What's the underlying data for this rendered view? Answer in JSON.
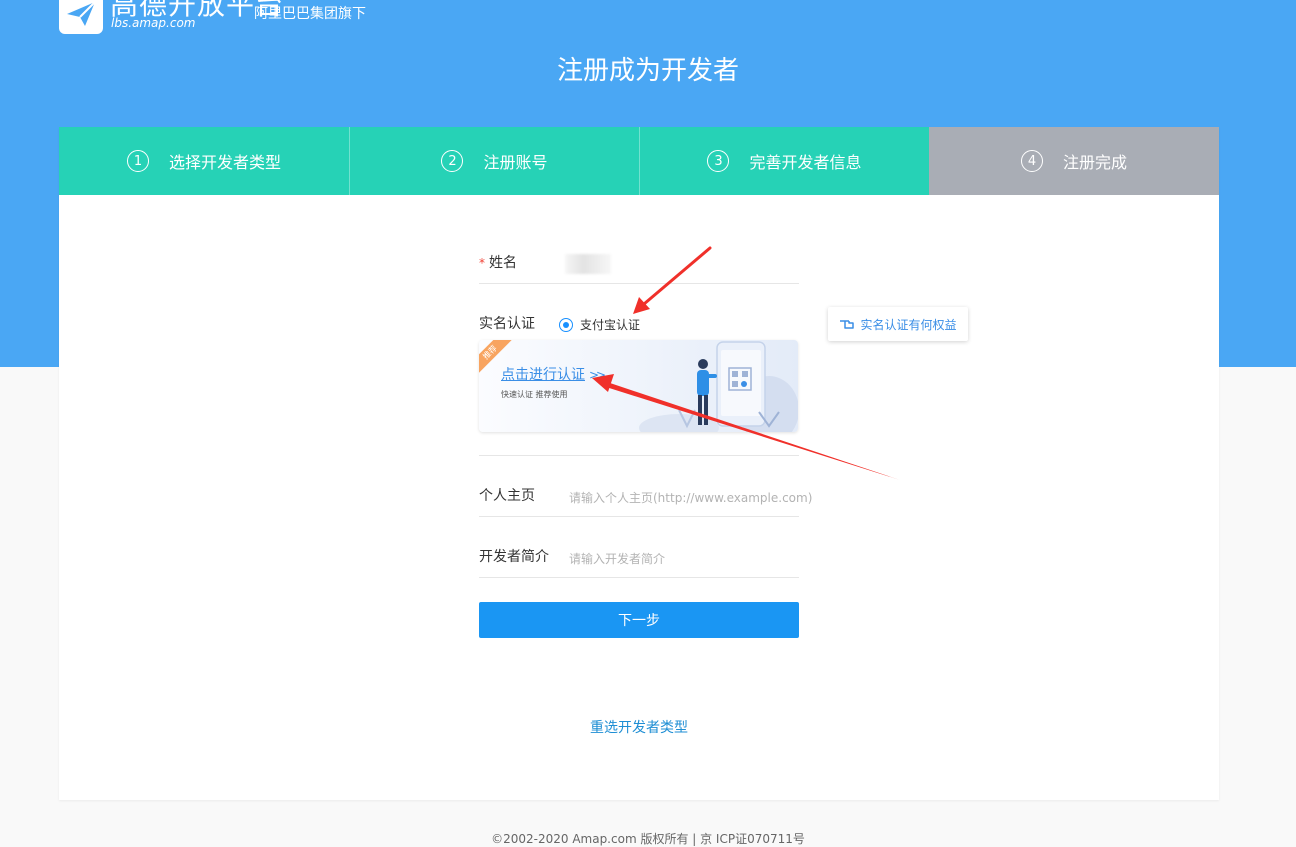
{
  "header": {
    "logo_title": "高德开放平台",
    "logo_domain": "lbs.amap.com",
    "logo_sub": "阿里巴巴集团旗下",
    "page_title": "注册成为开发者"
  },
  "steps": [
    {
      "num": "1",
      "label": "选择开发者类型",
      "state": "done"
    },
    {
      "num": "2",
      "label": "注册账号",
      "state": "done"
    },
    {
      "num": "3",
      "label": "完善开发者信息",
      "state": "done"
    },
    {
      "num": "4",
      "label": "注册完成",
      "state": "todo"
    }
  ],
  "form": {
    "name_label": "姓名",
    "required_mark": "*",
    "realname_label": "实名认证",
    "alipay_option": "支付宝认证",
    "rights_button": "实名认证有何权益",
    "auth_ribbon": "推荐",
    "auth_link": "点击进行认证",
    "auth_chevron": ">>",
    "auth_sub": "快速认证 推荐使用",
    "homepage_label": "个人主页",
    "homepage_placeholder": "请输入个人主页(http://www.example.com)",
    "intro_label": "开发者简介",
    "intro_placeholder": "请输入开发者简介",
    "next_button": "下一步",
    "reselect_link": "重选开发者类型"
  },
  "footer": {
    "copyright": "©2002-2020 Amap.com 版权所有 | 京 ICP证070711号"
  },
  "colors": {
    "hero_blue": "#4aa7f4",
    "step_done": "#26d2b6",
    "step_todo": "#a9adb5",
    "primary_button": "#1a96f3",
    "link": "#3a8ee6",
    "annotation_arrow": "#f0302a"
  }
}
